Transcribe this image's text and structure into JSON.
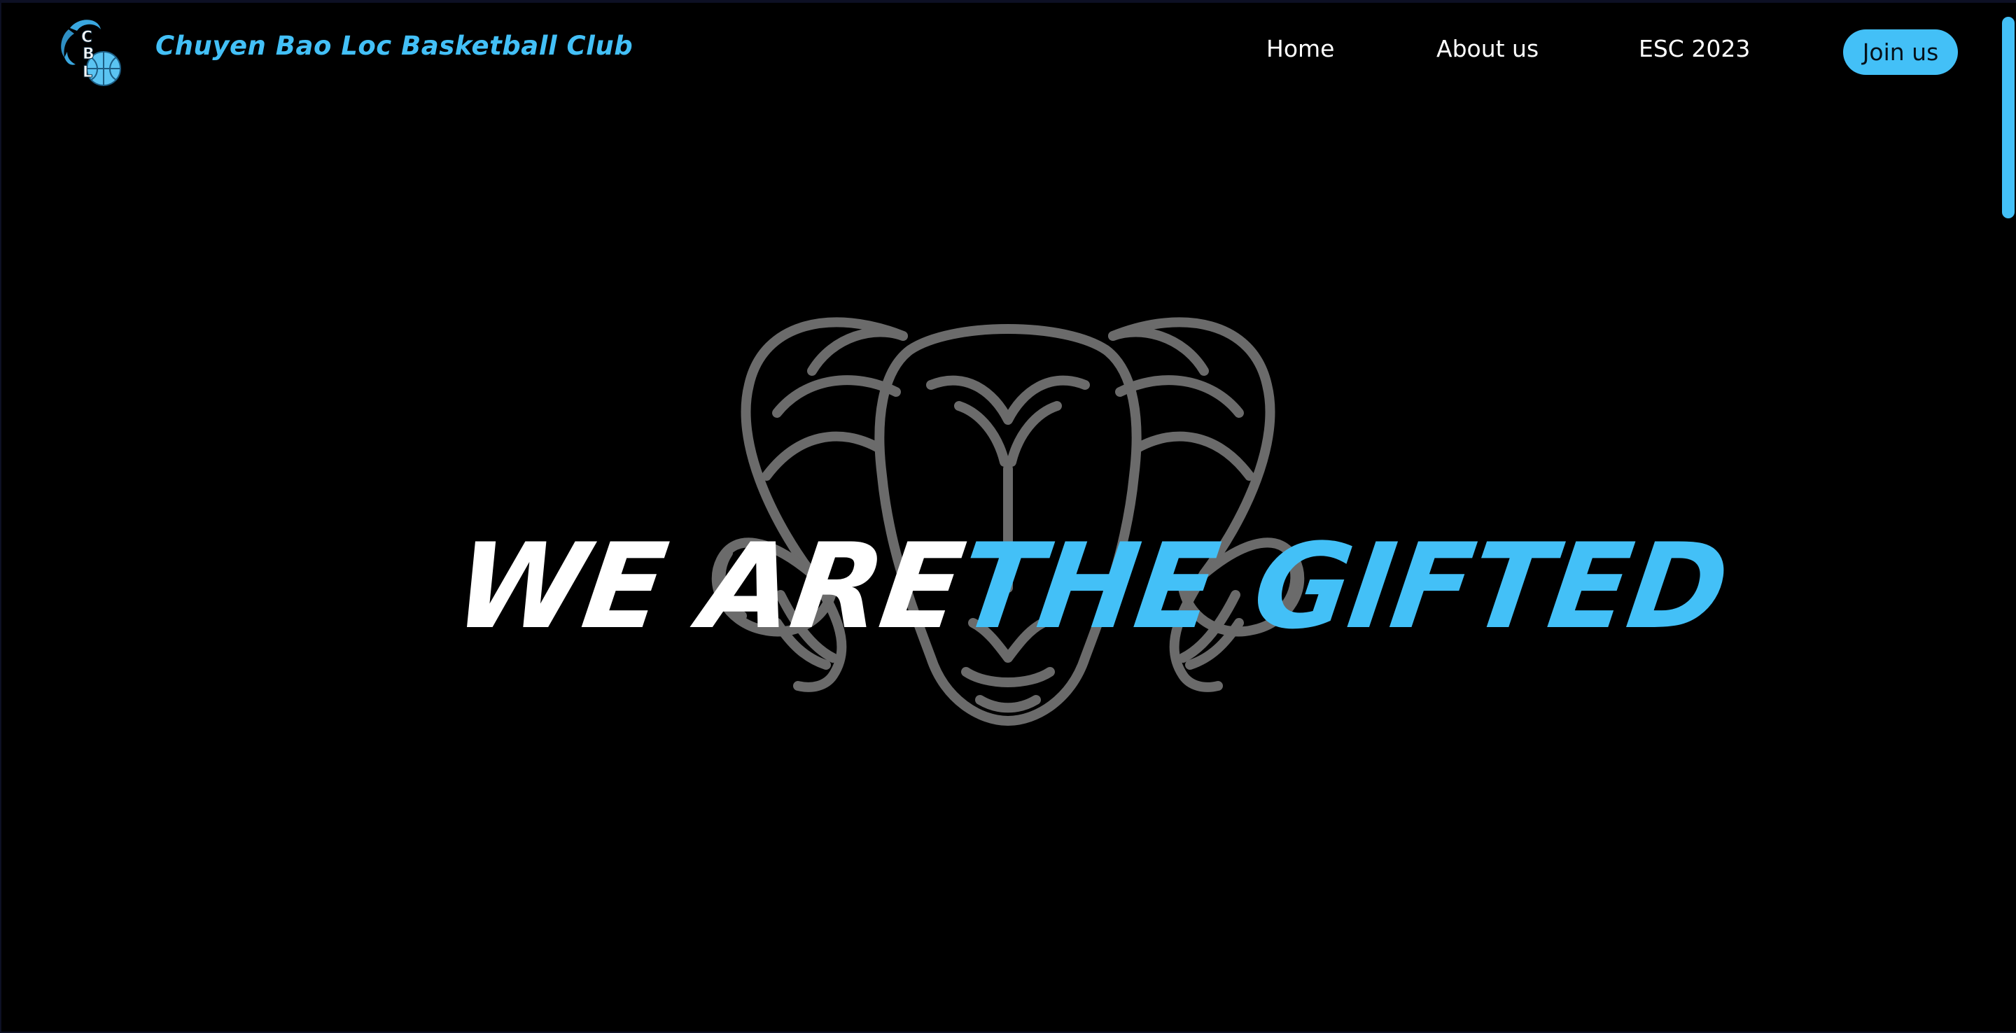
{
  "nav": {
    "logo_icon": "cbl-ram-basketball-logo",
    "site_title": "Chuyen Bao Loc Basketball Club",
    "links": [
      {
        "label": "Home"
      },
      {
        "label": "About us"
      },
      {
        "label": "ESC 2023"
      }
    ],
    "join_label": "Join us"
  },
  "hero": {
    "line_white": "WE ARE",
    "line_blue": "THE GIFTED",
    "background_icon": "ram-head-icon"
  },
  "colors": {
    "accent": "#43c0f7",
    "background": "#000000",
    "text": "#ffffff",
    "ram_outline": "#6b6b6b"
  }
}
